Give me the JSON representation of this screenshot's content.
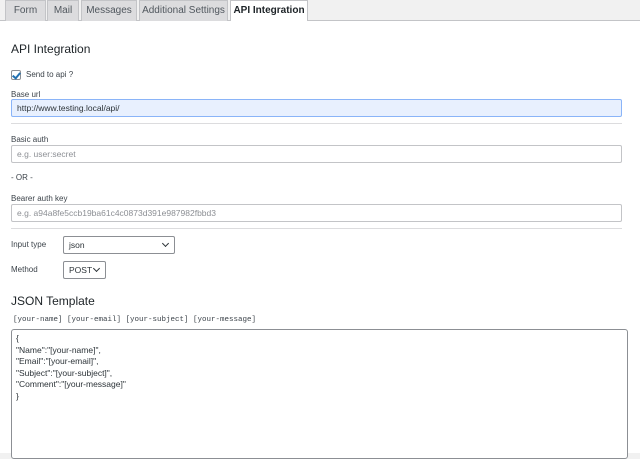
{
  "tabs": [
    {
      "label": "Form"
    },
    {
      "label": "Mail"
    },
    {
      "label": "Messages"
    },
    {
      "label": "Additional Settings"
    },
    {
      "label": "API Integration",
      "active": true
    }
  ],
  "section": {
    "title": "API Integration"
  },
  "send_to_api": {
    "label": "Send to api ?",
    "checked": true
  },
  "base_url": {
    "label": "Base url",
    "value": "http://www.testing.local/api/"
  },
  "basic_auth": {
    "label": "Basic auth",
    "placeholder": "e.g. user:secret"
  },
  "or_text": "- OR -",
  "bearer": {
    "label": "Bearer auth key",
    "placeholder": "e.g. a94a8fe5ccb19ba61c4c0873d391e987982fbbd3"
  },
  "input_type": {
    "label": "Input type",
    "value": "json"
  },
  "method": {
    "label": "Method",
    "value": "POST"
  },
  "json_template": {
    "title": "JSON Template",
    "tags": "[your-name] [your-email] [your-subject] [your-message]",
    "lines": [
      "{",
      "\"Name\":\"[your-name]\",",
      "\"Email\":\"[your-email]\",",
      "\"Subject\":\"[your-subject]\",",
      "\"Comment\":\"[your-message]\"",
      "}"
    ]
  }
}
